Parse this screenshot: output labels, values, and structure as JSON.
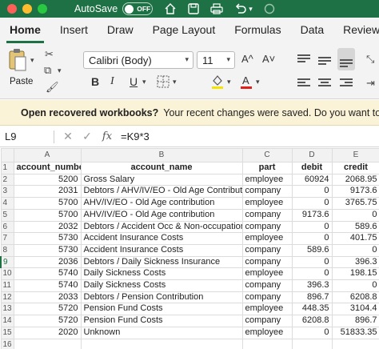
{
  "titlebar": {
    "autosave_label": "AutoSave",
    "toggle_state": "OFF"
  },
  "tabs": [
    "Home",
    "Insert",
    "Draw",
    "Page Layout",
    "Formulas",
    "Data",
    "Review"
  ],
  "ribbon": {
    "paste_label": "Paste",
    "font_name": "Calibri (Body)",
    "font_size": "11",
    "bold": "B",
    "italic": "I",
    "underline": "U",
    "font_grow": "A^",
    "font_shrink": "A˅"
  },
  "notification": {
    "title": "Open recovered workbooks?",
    "message": "Your recent changes were saved. Do you want to co"
  },
  "formula_bar": {
    "cell_ref": "L9",
    "formula": "=K9*3"
  },
  "columns": [
    "",
    "A",
    "B",
    "C",
    "D",
    "E"
  ],
  "rows": [
    {
      "n": "1",
      "a": "account_number",
      "b": "account_name",
      "c": "part",
      "d": "debit",
      "e": "credit"
    },
    {
      "n": "2",
      "a": "5200",
      "b": "Gross Salary",
      "c": "employee",
      "d": "60924",
      "e": "2068.95"
    },
    {
      "n": "3",
      "a": "2031",
      "b": "Debtors / AHV/IV/EO - Old Age Contribution",
      "c": "company",
      "d": "0",
      "e": "9173.6"
    },
    {
      "n": "4",
      "a": "5700",
      "b": "AHV/IV/EO - Old Age contribution",
      "c": "employee",
      "d": "0",
      "e": "3765.75"
    },
    {
      "n": "5",
      "a": "5700",
      "b": "AHV/IV/EO - Old Age contribution",
      "c": "company",
      "d": "9173.6",
      "e": "0"
    },
    {
      "n": "6",
      "a": "2032",
      "b": "Debtors / Accident Occ & Non-occupational",
      "c": "company",
      "d": "0",
      "e": "589.6"
    },
    {
      "n": "7",
      "a": "5730",
      "b": "Accident Insurance Costs",
      "c": "employee",
      "d": "0",
      "e": "401.75"
    },
    {
      "n": "8",
      "a": "5730",
      "b": "Accident Insurance Costs",
      "c": "company",
      "d": "589.6",
      "e": "0"
    },
    {
      "n": "9",
      "a": "2036",
      "b": "Debtors / Daily Sickness Insurance",
      "c": "company",
      "d": "0",
      "e": "396.3"
    },
    {
      "n": "10",
      "a": "5740",
      "b": "Daily Sickness Costs",
      "c": "employee",
      "d": "0",
      "e": "198.15"
    },
    {
      "n": "11",
      "a": "5740",
      "b": "Daily Sickness Costs",
      "c": "company",
      "d": "396.3",
      "e": "0"
    },
    {
      "n": "12",
      "a": "2033",
      "b": "Debtors / Pension Contribution",
      "c": "company",
      "d": "896.7",
      "e": "6208.8"
    },
    {
      "n": "13",
      "a": "5720",
      "b": "Pension Fund Costs",
      "c": "employee",
      "d": "448.35",
      "e": "3104.4"
    },
    {
      "n": "14",
      "a": "5720",
      "b": "Pension Fund Costs",
      "c": "company",
      "d": "6208.8",
      "e": "896.7"
    },
    {
      "n": "15",
      "a": "2020",
      "b": "Unknown",
      "c": "employee",
      "d": "0",
      "e": "51833.35"
    },
    {
      "n": "16",
      "a": "",
      "b": "",
      "c": "",
      "d": "",
      "e": ""
    }
  ]
}
